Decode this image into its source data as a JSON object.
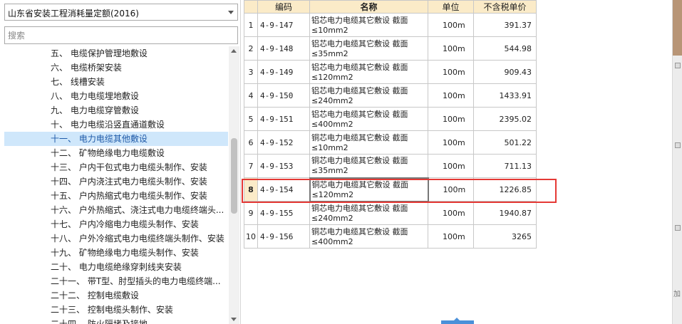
{
  "dropdown": {
    "value": "山东省安装工程消耗量定额(2016)"
  },
  "search": {
    "placeholder": "搜索"
  },
  "tree": {
    "items": [
      "五、  电缆保护管理地敷设",
      "六、  电缆桥架安装",
      "七、  线槽安装",
      "八、  电力电缆埋地敷设",
      "九、  电力电缆穿管敷设",
      "十、  电力电缆沿竖直通道敷设",
      "十一、  电力电缆其他敷设",
      "十二、  矿物绝缘电力电缆敷设",
      "十三、  户内干包式电力电缆头制作、安装",
      "十四、  户内浇注式电力电缆头制作、安装",
      "十五、  户内热缩式电力电缆头制作、安装",
      "十六、  户外热缩式、浇注式电力电缆终端头...",
      "十七、  户内冷缩电力电缆头制作、安装",
      "十八、  户外冷缩式电力电缆终端头制作、安装",
      "十九、  矿物绝缘电力电缆头制作、安装",
      "二十、  电力电缆绝缘穿刺线夹安装",
      "二十一、  带T型、肘型插头的电力电缆终端...",
      "二十二、  控制电缆敷设",
      "二十三、  控制电缆头制作、安装",
      "二十四、  防火隔堵及接地..."
    ],
    "selected_index": 6
  },
  "grid": {
    "headers": {
      "code": "编码",
      "name": "名称",
      "unit": "单位",
      "price": "不含税单价"
    },
    "current_row": 8,
    "rows": [
      {
        "n": "1",
        "code": "4-9-147",
        "name1": "铝芯电力电缆其它敷设 截面",
        "name2": "≤10mm2",
        "unit": "100m",
        "price": "391.37"
      },
      {
        "n": "2",
        "code": "4-9-148",
        "name1": "铝芯电力电缆其它敷设 截面",
        "name2": "≤35mm2",
        "unit": "100m",
        "price": "544.98"
      },
      {
        "n": "3",
        "code": "4-9-149",
        "name1": "铝芯电力电缆其它敷设 截面",
        "name2": "≤120mm2",
        "unit": "100m",
        "price": "909.43"
      },
      {
        "n": "4",
        "code": "4-9-150",
        "name1": "铝芯电力电缆其它敷设 截面",
        "name2": "≤240mm2",
        "unit": "100m",
        "price": "1433.91"
      },
      {
        "n": "5",
        "code": "4-9-151",
        "name1": "铝芯电力电缆其它敷设 截面",
        "name2": "≤400mm2",
        "unit": "100m",
        "price": "2395.02"
      },
      {
        "n": "6",
        "code": "4-9-152",
        "name1": "铜芯电力电缆其它敷设 截面",
        "name2": "≤10mm2",
        "unit": "100m",
        "price": "501.22"
      },
      {
        "n": "7",
        "code": "4-9-153",
        "name1": "铜芯电力电缆其它敷设 截面",
        "name2": "≤35mm2",
        "unit": "100m",
        "price": "711.13"
      },
      {
        "n": "8",
        "code": "4-9-154",
        "name1": "铜芯电力电缆其它敷设 截面",
        "name2": "≤120mm2",
        "unit": "100m",
        "price": "1226.85"
      },
      {
        "n": "9",
        "code": "4-9-155",
        "name1": "铜芯电力电缆其它敷设 截面",
        "name2": "≤240mm2",
        "unit": "100m",
        "price": "1940.87"
      },
      {
        "n": "10",
        "code": "4-9-156",
        "name1": "铜芯电力电缆其它敷设 截面",
        "name2": "≤400mm2",
        "unit": "100m",
        "price": "3265"
      }
    ]
  },
  "colors": {
    "header_bg": "#fbebc8",
    "selected_bg": "#cfe7fb",
    "highlight_border": "#e53935"
  },
  "strip": {
    "label": "加"
  }
}
